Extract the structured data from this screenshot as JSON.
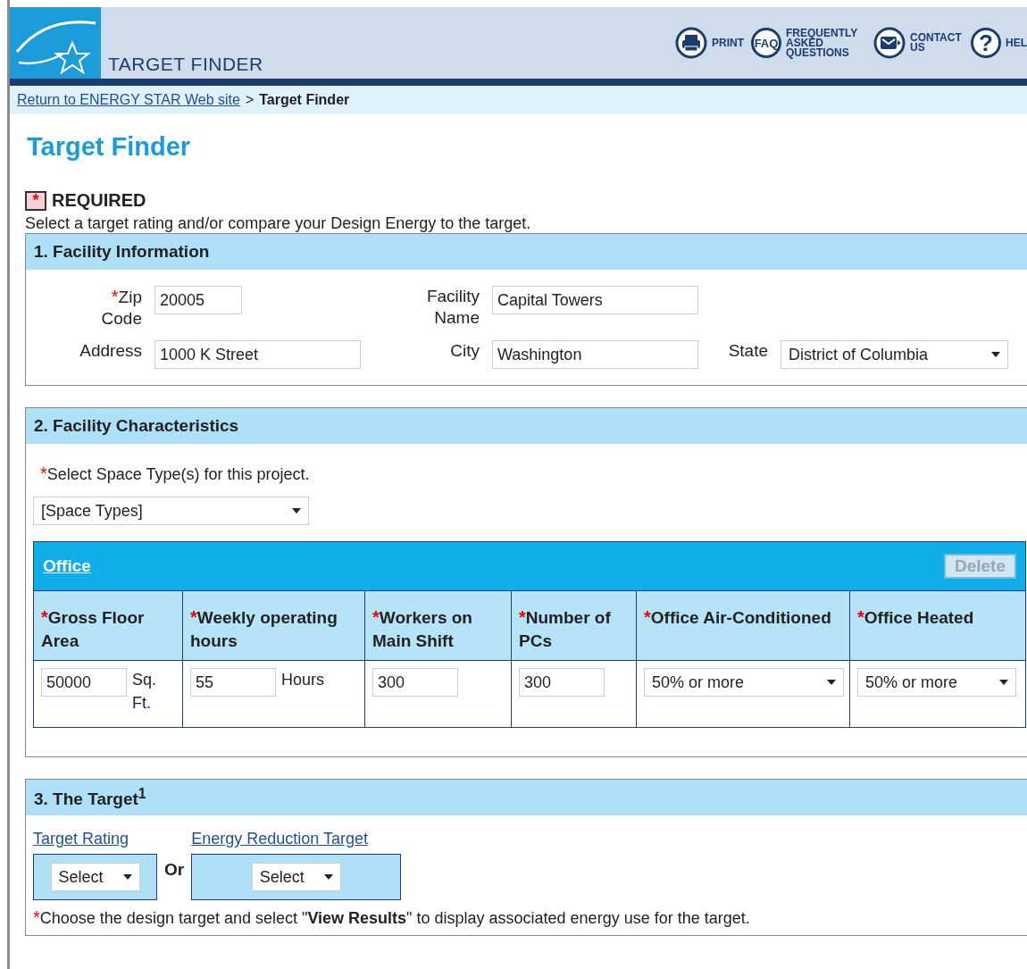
{
  "header": {
    "title": "TARGET FINDER",
    "nav": [
      {
        "kind": "print",
        "label": "PRINT"
      },
      {
        "kind": "faq",
        "badge": "FAQ",
        "label": "FREQUENTLY ASKED QUESTIONS"
      },
      {
        "kind": "contact",
        "label": "CONTACT US"
      },
      {
        "kind": "help",
        "badge": "?",
        "label": "HEL"
      }
    ]
  },
  "breadcrumb": {
    "link": "Return to ENERGY STAR Web site",
    "separator": ">",
    "current": "Target Finder"
  },
  "page_title": "Target Finder",
  "required_legend": {
    "mark": "*",
    "label": "REQUIRED"
  },
  "intro": "Select a target rating and/or compare your Design Energy to the target.",
  "facility_info": {
    "title": "1. Facility Information",
    "fields": [
      {
        "label": "Zip Code",
        "mark": "*",
        "value": "20005",
        "kind": "text"
      },
      {
        "label": "Facility Name",
        "value": "Capital Towers",
        "kind": "text"
      },
      {
        "label": "Address",
        "value": "1000 K Street",
        "kind": "text"
      },
      {
        "label": "City",
        "value": "Washington",
        "kind": "text"
      },
      {
        "label": "State",
        "value": "District of Columbia",
        "kind": "select"
      }
    ]
  },
  "facility_characteristics": {
    "title": "2. Facility Characteristics",
    "prompt_mark": "*",
    "prompt": "Select Space Type(s) for this project.",
    "space_select": "[Space Types]",
    "space": {
      "name": "Office",
      "delete": {
        "label": "Delete",
        "disabled": true
      },
      "columns": [
        {
          "mark": "*",
          "label": "Gross Floor Area"
        },
        {
          "mark": "*",
          "label": "Weekly operating hours"
        },
        {
          "mark": "*",
          "label": "Workers on Main Shift"
        },
        {
          "mark": "*",
          "label": "Number of PCs"
        },
        {
          "mark": "*",
          "label": "Office Air-Conditioned"
        },
        {
          "mark": "*",
          "label": "Office Heated"
        }
      ],
      "cells": [
        {
          "kind": "input",
          "value": "50000",
          "unit": "Sq. Ft."
        },
        {
          "kind": "input",
          "value": "55",
          "unit": "Hours"
        },
        {
          "kind": "input",
          "value": "300"
        },
        {
          "kind": "input",
          "value": "300"
        },
        {
          "kind": "select",
          "value": "50% or more"
        },
        {
          "kind": "select",
          "value": "50% or more"
        }
      ]
    }
  },
  "target": {
    "title": "3. The Target$^{1}$",
    "options": [
      {
        "link": "Target Rating",
        "select": "Select"
      },
      {
        "link": "Energy Reduction Target",
        "select": "Select"
      }
    ],
    "or": "Or",
    "note_mark": "*",
    "note": "Choose the design target and select \"**View Results**\" to display associated energy use for the target."
  }
}
